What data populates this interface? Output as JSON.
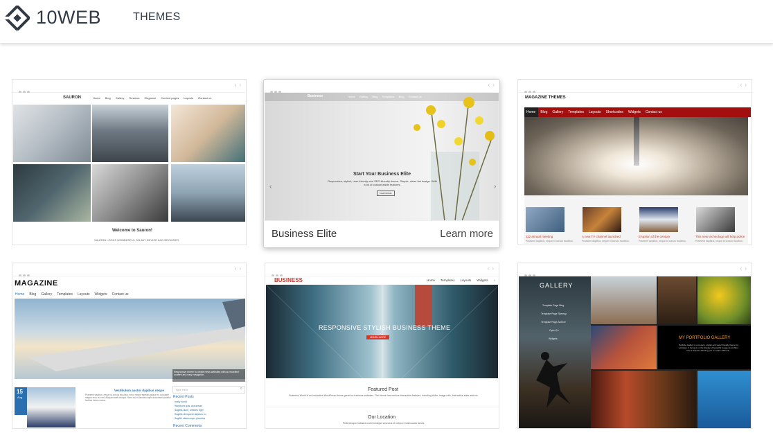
{
  "header": {
    "brand": "10WEB",
    "nav_themes": "THEMES"
  },
  "themes": [
    {
      "id": "sauron",
      "logo_text": "SAURON",
      "nav": [
        "Home",
        "Blog",
        "Gallery",
        "Reviews",
        "Elegance",
        "Content pages",
        "Layouts",
        "Contact us"
      ],
      "welcome": "Welcome to Sauron!",
      "tagline": "SAURON LOOKS WONDERFUL ON ANY DEVICE AND BROWSER"
    },
    {
      "id": "business-elite",
      "logo_text": "Business",
      "nav": [
        "Home",
        "Gallery",
        "Blog",
        "Templates",
        "Tech (dropdown)",
        "Blog",
        "Contact us"
      ],
      "hero_title": "Start Your Business Elite",
      "hero_desc": "Responsive, stylish, user friendly and SEO-friendly theme. Simple, clean flat design. With a lot of customizable features.",
      "hero_button": "VIEW MORE",
      "name": "Business Elite",
      "learn_more": "Learn more"
    },
    {
      "id": "magazine-themes",
      "logo_text": "MAGAZINE THEMES",
      "nav": [
        "Home",
        "Blog",
        "Gallery",
        "Templates",
        "Layouts",
        "Shortcodes",
        "Widgets",
        "Contact us"
      ],
      "posts": [
        {
          "title": "112 annual meeting",
          "excerpt": "Praesent dapibus, neque id cursus faucibus."
        },
        {
          "title": "A new TV channel launched",
          "excerpt": "Praesent dapibus, neque id cursus faucibus."
        },
        {
          "title": "Eruption of the century",
          "excerpt": "Praesent dapibus, neque id cursus faucibus."
        },
        {
          "title": "This new technology will help police",
          "excerpt": "Praesent dapibus, neque id cursus faucibus."
        }
      ]
    },
    {
      "id": "magazine",
      "logo_text": "MAGAZINE",
      "nav": [
        "Home",
        "Blog",
        "Gallery",
        "Templates",
        "Layouts",
        "Widgets",
        "Contact us"
      ],
      "caption": "Responsive theme to create news websites with an excellent content and easy navigation",
      "date_day": "15",
      "date_month": "Aug",
      "article_title": "Vestibulum auctor dapibus neque",
      "article_text": "Praesent dapibus, neque id cursus faucibus, tortor neque egestas augue eu vulputate magna eros eu erat. Aliquam erat volutpat. Nam dui mi tincidunt quis accumsan porttitor facilisis luctus metus.",
      "search_placeholder": "Type Here",
      "recent_posts_label": "Recent Posts",
      "recent_posts": [
        "really world",
        "Wordlunit quis, accumsan",
        "Sagittis diam, ultricies eget",
        "Sagittis dienquest dapibus cu",
        "Sagittir ullamcorper pharetra"
      ],
      "recent_comments_label": "Recent Comments"
    },
    {
      "id": "business-world",
      "logo_text": "BUSINESS",
      "nav": [
        "Home",
        "Templates",
        "Layouts",
        "Widgets"
      ],
      "hero_title": "RESPONSIVE STYLISH BUSINESS THEME",
      "hero_button": "LEARN MORE",
      "featured_title": "Featured Post",
      "featured_text": "Business World is an innovative WordPress theme great for business websites. The theme has various interactive features, including slider, image rolls, interactive stats and etc.",
      "location_title": "Our Location",
      "location_text": "Pellentesque habitant morbi tristique senectus et netus et malesuada fames."
    },
    {
      "id": "gallery",
      "logo_text": "GALLERY",
      "menu": [
        "Template Page Blog",
        "Template Page Sitemap",
        "Template Page Archive",
        "Open Pe",
        "Widgets"
      ],
      "portfolio_title": "MY PORTFOLIO GALLERY",
      "portfolio_text": "Portfolio Gallery is a modern, stylish and super friendly theme for websites. It focuses on the display of beautiful images and offers lots of features allowing you to create different..."
    }
  ],
  "colors": {
    "brand_text": "#323a45",
    "magazine_nav_red": "#a30f0f",
    "magazine_accent": "#c0392b",
    "business_red": "#d23a2e",
    "gallery_accent": "#f2a33a"
  }
}
